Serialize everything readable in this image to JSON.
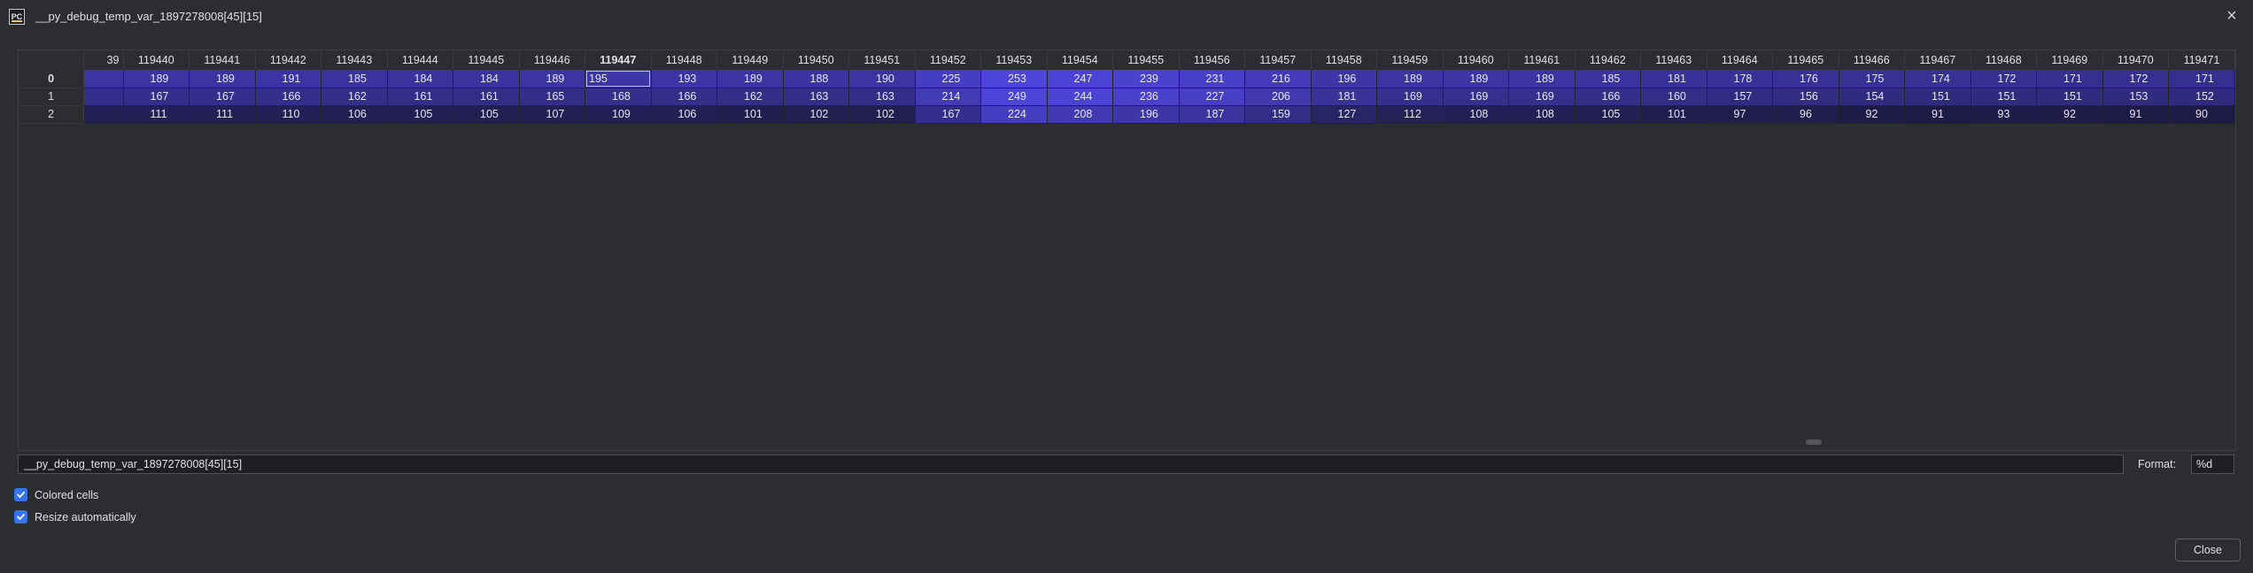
{
  "window": {
    "title": "__py_debug_temp_var_1897278008[45][15]",
    "app_icon_text": "PC"
  },
  "grid": {
    "partial_column_label": "39",
    "columns": [
      "119440",
      "119441",
      "119442",
      "119443",
      "119444",
      "119445",
      "119446",
      "119447",
      "119448",
      "119449",
      "119450",
      "119451",
      "119452",
      "119453",
      "119454",
      "119455",
      "119456",
      "119457",
      "119458",
      "119459",
      "119460",
      "119461",
      "119462",
      "119463",
      "119464",
      "119465",
      "119466",
      "119467",
      "119468",
      "119469",
      "119470",
      "119471"
    ],
    "bold_column": "119447",
    "rows": [
      {
        "label": "0",
        "bold": true,
        "values": [
          189,
          189,
          191,
          185,
          184,
          184,
          189,
          195,
          193,
          189,
          188,
          190,
          225,
          253,
          247,
          239,
          231,
          216,
          196,
          189,
          189,
          189,
          185,
          181,
          178,
          176,
          175,
          174,
          172,
          171,
          172,
          171
        ]
      },
      {
        "label": "1",
        "bold": false,
        "values": [
          167,
          167,
          166,
          162,
          161,
          161,
          165,
          168,
          166,
          162,
          163,
          163,
          214,
          249,
          244,
          236,
          227,
          206,
          181,
          169,
          169,
          169,
          166,
          160,
          157,
          156,
          154,
          151,
          151,
          151,
          153,
          152
        ]
      },
      {
        "label": "2",
        "bold": false,
        "values": [
          111,
          111,
          110,
          106,
          105,
          105,
          107,
          109,
          106,
          101,
          102,
          102,
          167,
          224,
          208,
          196,
          187,
          159,
          127,
          112,
          108,
          108,
          105,
          101,
          97,
          96,
          92,
          91,
          93,
          92,
          91,
          90
        ]
      }
    ],
    "selected": {
      "row": 0,
      "col": 7
    },
    "color_range": {
      "min": 90,
      "max": 253
    },
    "color_low": "#1d1b45",
    "color_high": "#4e45dc"
  },
  "expression": {
    "value": "__py_debug_temp_var_1897278008[45][15]"
  },
  "format": {
    "label": "Format:",
    "value": "%d"
  },
  "options": {
    "colored_cells_label": "Colored cells",
    "colored_cells_checked": true,
    "resize_auto_label": "Resize automatically",
    "resize_auto_checked": true
  },
  "buttons": {
    "close_label": "Close"
  },
  "colors": {
    "accent": "#3574f0",
    "background": "#2b2d30"
  }
}
